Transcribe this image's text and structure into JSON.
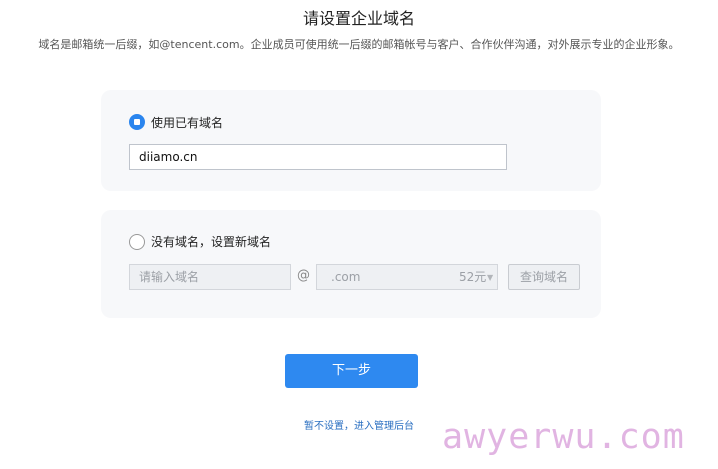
{
  "header": {
    "title": "请设置企业域名",
    "description": "域名是邮箱统一后缀，如@tencent.com。企业成员可使用统一后缀的邮箱帐号与客户、合作伙伴沟通，对外展示专业的企业形象。"
  },
  "option_existing": {
    "label": "使用已有域名",
    "selected": true,
    "domain_value": "diiamo.cn"
  },
  "option_new": {
    "label": "没有域名，设置新域名",
    "selected": false,
    "name_placeholder": "请输入域名",
    "at_symbol": "@",
    "suffix_value": ".com",
    "price": "52元",
    "query_button": "查询域名"
  },
  "actions": {
    "next_button": "下一步",
    "skip_link": "暂不设置，进入管理后台"
  },
  "watermark": "awyerwu.com",
  "colors": {
    "accent": "#2e89f0",
    "link": "#2a6fc1",
    "card_bg": "#f7f8fa",
    "watermark": "#dca8dd"
  },
  "icons": {
    "selected_radio": "radio-checked-icon",
    "unselected_radio": "radio-unchecked-icon",
    "dropdown_caret": "caret-down-icon"
  }
}
